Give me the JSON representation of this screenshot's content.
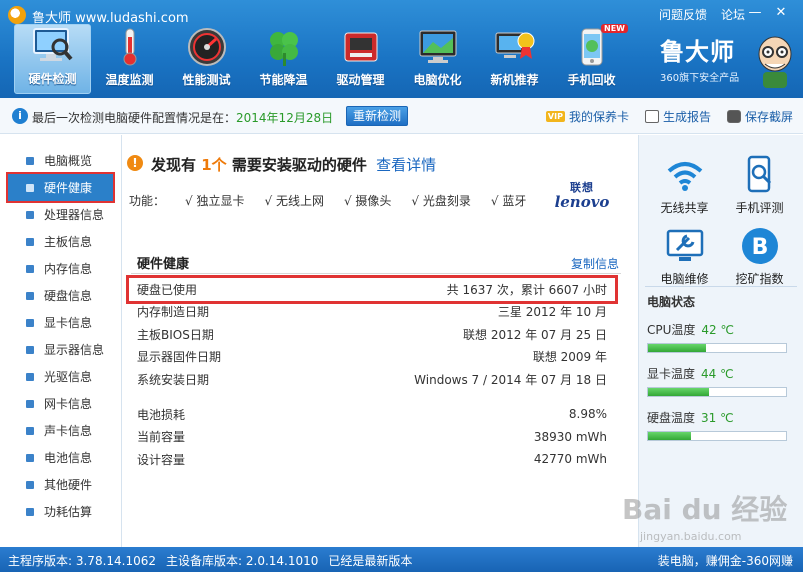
{
  "window": {
    "title": "鲁大师 www.ludashi.com",
    "links": [
      "问题反馈",
      "论坛"
    ],
    "minimize": "—",
    "close": "✕"
  },
  "toolbar": {
    "items": [
      {
        "label": "硬件检测",
        "icon": "monitor-magnifier-icon"
      },
      {
        "label": "温度监测",
        "icon": "thermometer-icon"
      },
      {
        "label": "性能测试",
        "icon": "speedometer-icon"
      },
      {
        "label": "节能降温",
        "icon": "clover-icon"
      },
      {
        "label": "驱动管理",
        "icon": "chip-icon"
      },
      {
        "label": "电脑优化",
        "icon": "monitor-icon"
      },
      {
        "label": "新机推荐",
        "icon": "pc-award-icon"
      },
      {
        "label": "手机回收",
        "icon": "phone-icon",
        "badge": "NEW"
      }
    ],
    "active_index": 0
  },
  "brand": {
    "name": "鲁大师",
    "sub": "360旗下安全产品"
  },
  "infobar": {
    "text": "最后一次检测电脑硬件配置情况是在：",
    "date": "2014年12月28日",
    "recheck": "重新检测",
    "vip_badge": "VIP",
    "warranty": "我的保养卡",
    "report": "生成报告",
    "screenshot": "保存截屏"
  },
  "sidebar": {
    "items": [
      "电脑概览",
      "硬件健康",
      "处理器信息",
      "主板信息",
      "内存信息",
      "硬盘信息",
      "显卡信息",
      "显示器信息",
      "光驱信息",
      "网卡信息",
      "声卡信息",
      "电池信息",
      "其他硬件",
      "功耗估算"
    ],
    "active_index": 1
  },
  "main": {
    "headline_pre": "发现有",
    "headline_num": "1个",
    "headline_post": "需要安装驱动的硬件",
    "headline_link": "查看详情",
    "features": [
      "功能：",
      "√ 独立显卡",
      "√ 无线上网",
      "√ 摄像头",
      "√ 光盘刻录",
      "√ 蓝牙"
    ],
    "vendor_cn": "联想",
    "vendor_en": "lenovo",
    "section_title": "硬件健康",
    "copy_link": "复制信息",
    "rows": [
      {
        "k": "硬盘已使用",
        "v": "共 1637 次，累计 6607 小时"
      },
      {
        "k": "内存制造日期",
        "v": "三星 2012 年 10 月"
      },
      {
        "k": "主板BIOS日期",
        "v": "联想 2012 年 07 月 25 日"
      },
      {
        "k": "显示器固件日期",
        "v": "联想 2009 年"
      },
      {
        "k": "系统安装日期",
        "v": "Windows 7 / 2014 年 07 月 18 日"
      }
    ],
    "battery_rows": [
      {
        "k": "电池损耗",
        "v": "8.98%"
      },
      {
        "k": "当前容量",
        "v": "38930 mWh"
      },
      {
        "k": "设计容量",
        "v": "42770 mWh"
      }
    ]
  },
  "rpanel": {
    "tiles": [
      {
        "label": "无线共享",
        "icon": "wifi-icon"
      },
      {
        "label": "手机评测",
        "icon": "phone-search-icon"
      },
      {
        "label": "电脑维修",
        "icon": "wrench-icon"
      },
      {
        "label": "挖矿指数",
        "icon": "bitcoin-icon"
      }
    ],
    "status_title": "电脑状态",
    "temps": [
      {
        "label": "CPU温度",
        "value": "42 ℃",
        "level": 0.42
      },
      {
        "label": "显卡温度",
        "value": "44 ℃",
        "level": 0.44
      },
      {
        "label": "硬盘温度",
        "value": "31 ℃",
        "level": 0.31
      }
    ]
  },
  "footer": {
    "main_version": "主程序版本: 3.78.14.1062",
    "db_version": "主设备库版本: 2.0.14.1010",
    "latest": "已经是最新版本",
    "right": "装电脑，赚佣金-360网赚"
  },
  "watermark": {
    "text": "Bai du 经验",
    "sub": "jingyan.baidu.com"
  },
  "colors": {
    "accent": "#1a74c4",
    "highlight": "#e03333",
    "ok": "#2a9a2a",
    "warn": "#ee7a0a"
  }
}
